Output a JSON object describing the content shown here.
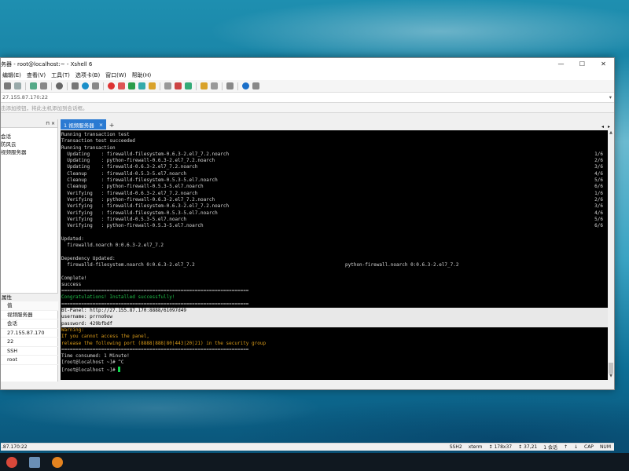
{
  "window": {
    "title": "务器 - root@localhost:~ - Xshell 6",
    "minimize": "—",
    "maximize": "☐",
    "close": "✕"
  },
  "menu": [
    "编辑(E)",
    "查看(V)",
    "工具(T)",
    "选项卡(B)",
    "窗口(W)",
    "帮助(H)"
  ],
  "address": {
    "value": "27.155.87.170:22"
  },
  "hint": {
    "text": "击添加按钮，将此主机添加到会话框。"
  },
  "sidebar": {
    "pin": "⊓ ×",
    "items": [
      "会话",
      "防风云",
      "视频服务器"
    ]
  },
  "properties": {
    "header": "属性",
    "column": "值",
    "values": [
      "视频服务器",
      "会话",
      "27.155.87.170",
      "22",
      "SSH",
      "root"
    ]
  },
  "tabs": {
    "active": "1 视频服务器",
    "close": "×",
    "add": "+",
    "prev": "◂",
    "next": "▸"
  },
  "terminal": {
    "lines": [
      {
        "t": "Running transaction test"
      },
      {
        "t": "Transaction test succeeded"
      },
      {
        "t": "Running transaction"
      },
      {
        "t": "  Updating    : firewalld-filesystem-0.6.3-2.el7_7.2.noarch",
        "r": "1/6"
      },
      {
        "t": "  Updating    : python-firewall-0.6.3-2.el7_7.2.noarch",
        "r": "2/6"
      },
      {
        "t": "  Updating    : firewalld-0.6.3-2.el7_7.2.noarch",
        "r": "3/6"
      },
      {
        "t": "  Cleanup     : firewalld-0.5.3-5.el7.noarch",
        "r": "4/6"
      },
      {
        "t": "  Cleanup     : firewalld-filesystem-0.5.3-5.el7.noarch",
        "r": "5/6"
      },
      {
        "t": "  Cleanup     : python-firewall-0.5.3-5.el7.noarch",
        "r": "6/6"
      },
      {
        "t": "  Verifying   : firewalld-0.6.3-2.el7_7.2.noarch",
        "r": "1/6"
      },
      {
        "t": "  Verifying   : python-firewall-0.6.3-2.el7_7.2.noarch",
        "r": "2/6"
      },
      {
        "t": "  Verifying   : firewalld-filesystem-0.6.3-2.el7_7.2.noarch",
        "r": "3/6"
      },
      {
        "t": "  Verifying   : firewalld-filesystem-0.5.3-5.el7.noarch",
        "r": "4/6"
      },
      {
        "t": "  Verifying   : firewalld-0.5.3-5.el7.noarch",
        "r": "5/6"
      },
      {
        "t": "  Verifying   : python-firewall-0.5.3-5.el7.noarch",
        "r": "6/6"
      },
      {
        "t": ""
      },
      {
        "t": "Updated:"
      },
      {
        "t": "  firewalld.noarch 0:0.6.3-2.el7_7.2"
      },
      {
        "t": ""
      },
      {
        "t": "Dependency Updated:"
      },
      {
        "t": "  firewalld-filesystem.noarch 0:0.6.3-2.el7_7.2",
        "c2": "python-firewall.noarch 0:0.6.3-2.el7_7.2"
      },
      {
        "t": ""
      },
      {
        "t": "Complete!"
      },
      {
        "t": "success"
      },
      {
        "t": "=================================================================="
      },
      {
        "t": "Congratulations! Installed successfully!",
        "s": "green"
      },
      {
        "t": "=================================================================="
      },
      {
        "t": "Bt-Panel: http://27.155.87.170:8888/61097d49",
        "s": "hl"
      },
      {
        "t": "username: prrno9ow",
        "s": "hl"
      },
      {
        "t": "password: 429bfbdf",
        "s": "hl"
      },
      {
        "t": "Warning:",
        "s": "warn"
      },
      {
        "t": "If you cannot access the panel,",
        "s": "warn"
      },
      {
        "t": "release the following port (8888|888|80|443|20|21) in the security group",
        "s": "warn"
      },
      {
        "t": "=================================================================="
      },
      {
        "t": "Time consumed: 1 Minute!"
      },
      {
        "t": "[root@localhost ~]# ^C"
      },
      {
        "t": "[root@localhost ~]# ",
        "cursor": true
      }
    ]
  },
  "status": {
    "left": ".87.170:22",
    "items": [
      "SSH2",
      "xterm",
      "↕ 178x37",
      "↕ 37,21",
      "1 会话",
      "↑",
      "↓",
      "CAP",
      "NUM"
    ]
  },
  "colors": {
    "accent": "#2a7ad2",
    "terminal_bg": "#000000",
    "terminal_fg": "#d8d8d8",
    "success_green": "#1fbf48",
    "warning_orange": "#d99b1a"
  }
}
